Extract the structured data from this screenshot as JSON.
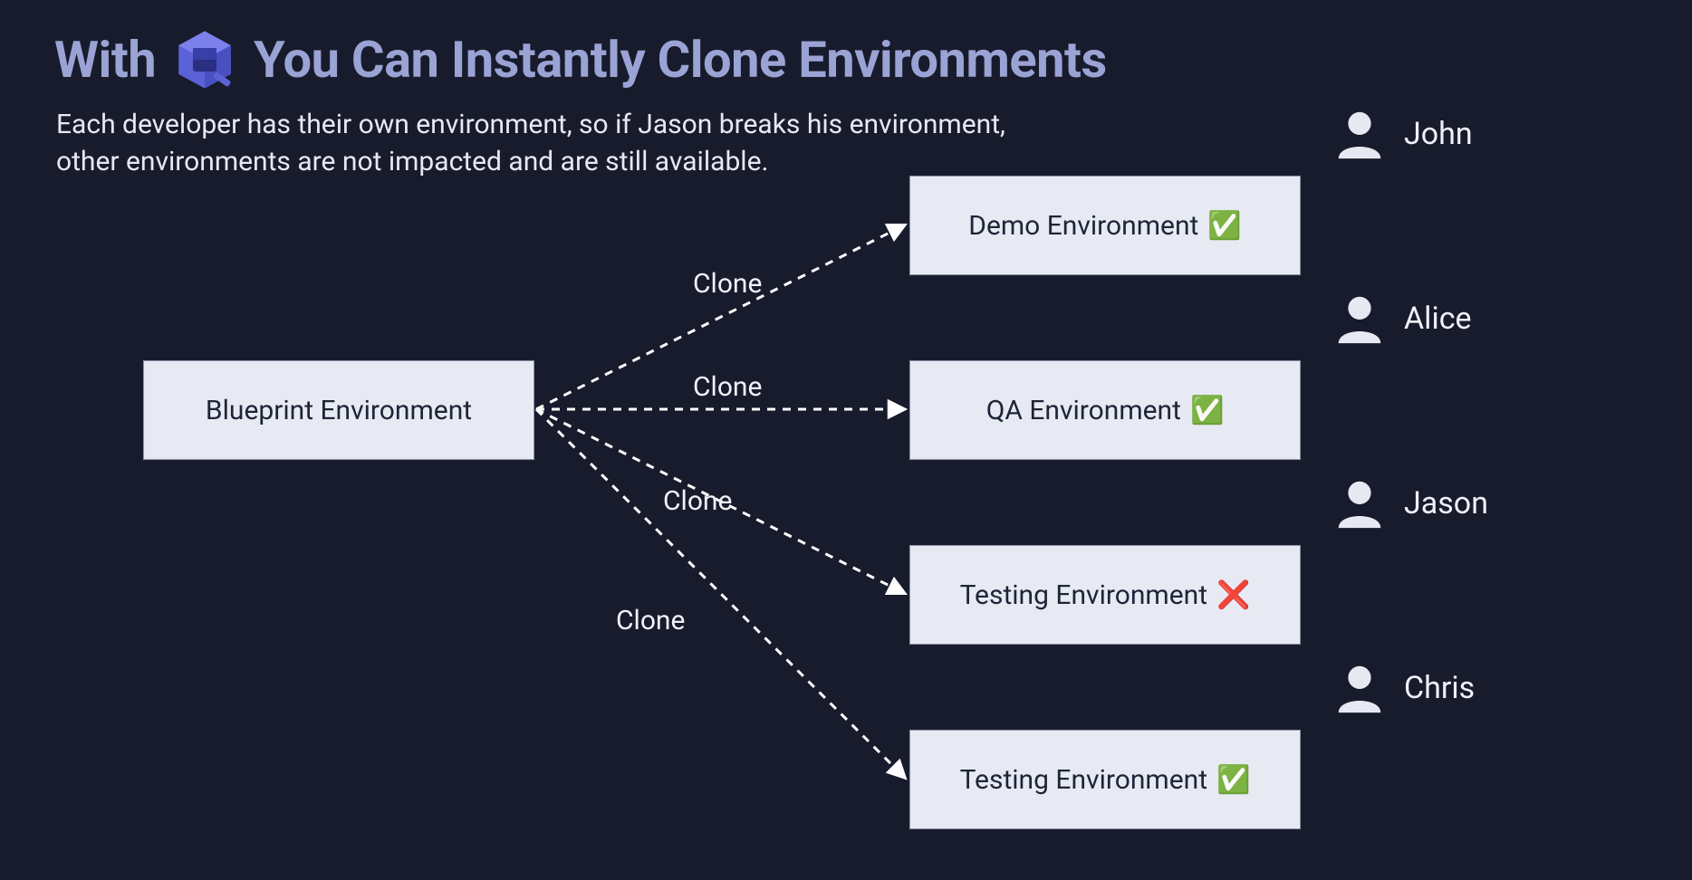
{
  "title": {
    "prefix": "With",
    "suffix": "You Can Instantly Clone Environments"
  },
  "subtitle": "Each developer has their own environment, so if Jason breaks his environment, other environments are not impacted and are still available.",
  "source": {
    "label": "Blueprint Environment"
  },
  "edge_label": "Clone",
  "targets": [
    {
      "label": "Demo Environment",
      "status": "ok",
      "user": "John"
    },
    {
      "label": "QA Environment",
      "status": "ok",
      "user": "Alice"
    },
    {
      "label": "Testing Environment",
      "status": "fail",
      "user": "Jason"
    },
    {
      "label": "Testing Environment",
      "status": "ok",
      "user": "Chris"
    }
  ],
  "status_glyphs": {
    "ok": "✅",
    "fail": "❌"
  },
  "colors": {
    "background": "#171b2c",
    "title": "#9aa3d4",
    "text": "#e6e9f2",
    "box_bg": "#e7eaf3",
    "box_text": "#1d2537",
    "logo_primary": "#5b61d6",
    "logo_accent": "#393fa8"
  }
}
